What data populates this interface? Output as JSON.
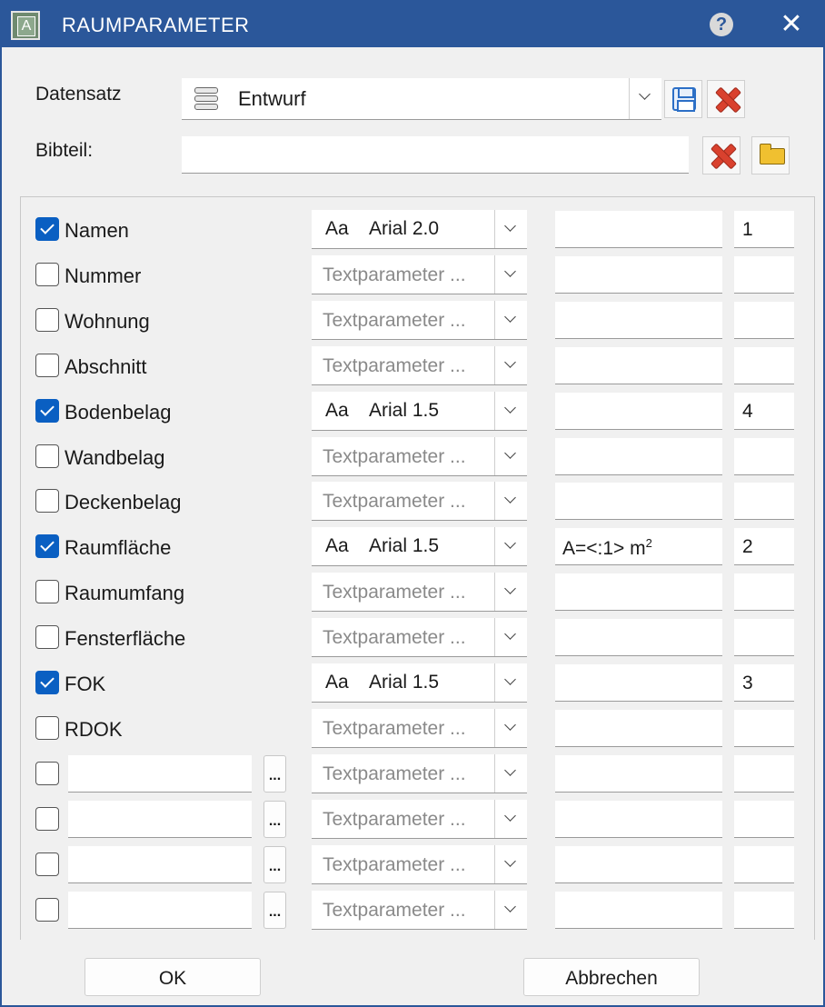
{
  "window": {
    "title": "RAUMPARAMETER",
    "app_icon_letter": "A",
    "help_label": "?",
    "close_label": "✕"
  },
  "datensatz": {
    "label": "Datensatz",
    "value": "Entwurf"
  },
  "bibteil": {
    "label": "Bibteil:",
    "value": ""
  },
  "placeholder": "Textparameter ...",
  "font_prefix": "Aa",
  "ellipsis": "...",
  "rows": [
    {
      "checked": true,
      "label": "Namen",
      "font": "Arial 2.0",
      "format": "",
      "format_sup": "",
      "num": "1"
    },
    {
      "checked": false,
      "label": "Nummer",
      "font": "",
      "format": "",
      "format_sup": "",
      "num": ""
    },
    {
      "checked": false,
      "label": "Wohnung",
      "font": "",
      "format": "",
      "format_sup": "",
      "num": ""
    },
    {
      "checked": false,
      "label": "Abschnitt",
      "font": "",
      "format": "",
      "format_sup": "",
      "num": ""
    },
    {
      "checked": true,
      "label": "Bodenbelag",
      "font": "Arial 1.5",
      "format": "",
      "format_sup": "",
      "num": "4"
    },
    {
      "checked": false,
      "label": "Wandbelag",
      "font": "",
      "format": "",
      "format_sup": "",
      "num": ""
    },
    {
      "checked": false,
      "label": "Deckenbelag",
      "font": "",
      "format": "",
      "format_sup": "",
      "num": ""
    },
    {
      "checked": true,
      "label": "Raumfläche",
      "font": "Arial 1.5",
      "format": "A=<:1> m",
      "format_sup": "2",
      "num": "2"
    },
    {
      "checked": false,
      "label": "Raumumfang",
      "font": "",
      "format": "",
      "format_sup": "",
      "num": ""
    },
    {
      "checked": false,
      "label": "Fensterfläche",
      "font": "",
      "format": "",
      "format_sup": "",
      "num": ""
    },
    {
      "checked": true,
      "label": "FOK",
      "font": "Arial 1.5",
      "format": "",
      "format_sup": "",
      "num": "3"
    },
    {
      "checked": false,
      "label": "RDOK",
      "font": "",
      "format": "",
      "format_sup": "",
      "num": ""
    }
  ],
  "custom_rows": [
    {
      "checked": false,
      "name": "",
      "num": ""
    },
    {
      "checked": false,
      "name": "",
      "num": ""
    },
    {
      "checked": false,
      "name": "",
      "num": ""
    },
    {
      "checked": false,
      "name": "",
      "num": ""
    }
  ],
  "buttons": {
    "ok": "OK",
    "cancel": "Abbrechen"
  },
  "colors": {
    "titlebar": "#2b579a",
    "checkbox_checked": "#0a5fc2",
    "delete_icon": "#d9412e",
    "save_icon": "#2c6fc6",
    "folder_icon": "#f0c030"
  },
  "icons": {
    "datensatz": "database-icon",
    "save": "floppy-disk-icon",
    "delete": "red-x-icon",
    "browse": "open-folder-icon",
    "help": "help-circle-icon",
    "close": "close-icon"
  }
}
